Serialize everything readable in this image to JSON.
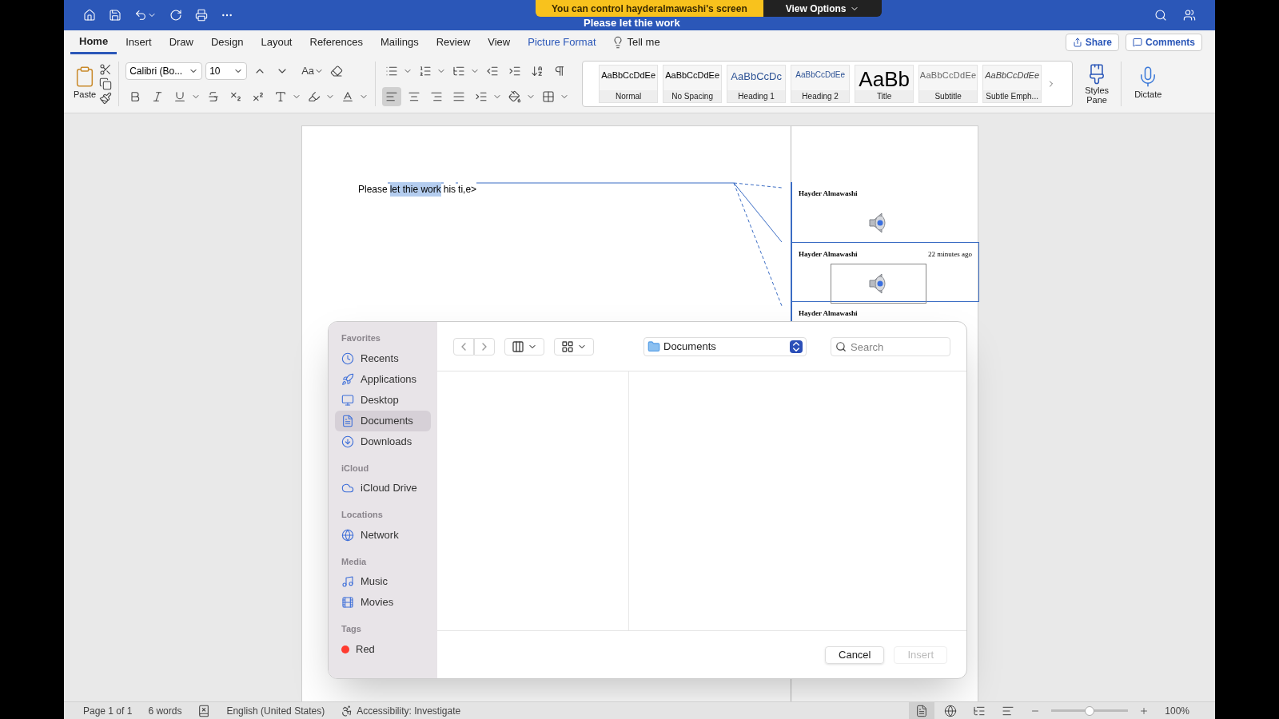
{
  "banner": {
    "message": "You can control hayderalmawashi's screen",
    "options": "View Options"
  },
  "window": {
    "title": "Please let thie work"
  },
  "tabs": [
    {
      "label": "Home",
      "selected": true,
      "contextual": false
    },
    {
      "label": "Insert",
      "selected": false,
      "contextual": false
    },
    {
      "label": "Draw",
      "selected": false,
      "contextual": false
    },
    {
      "label": "Design",
      "selected": false,
      "contextual": false
    },
    {
      "label": "Layout",
      "selected": false,
      "contextual": false
    },
    {
      "label": "References",
      "selected": false,
      "contextual": false
    },
    {
      "label": "Mailings",
      "selected": false,
      "contextual": false
    },
    {
      "label": "Review",
      "selected": false,
      "contextual": false
    },
    {
      "label": "View",
      "selected": false,
      "contextual": false
    },
    {
      "label": "Picture Format",
      "selected": false,
      "contextual": true
    }
  ],
  "tell_me": "Tell me",
  "share": "Share",
  "comments_button": "Comments",
  "ribbon": {
    "paste": "Paste",
    "font": "Calibri (Bo...",
    "size": "10",
    "case": "Aa",
    "styles_pane": "Styles Pane",
    "dictate": "Dictate",
    "styles": [
      {
        "preview": "AaBbCcDdEe",
        "name": "Normal",
        "kind": "normal"
      },
      {
        "preview": "AaBbCcDdEe",
        "name": "No Spacing",
        "kind": "normal"
      },
      {
        "preview": "AaBbCcDc",
        "name": "Heading 1",
        "kind": "heading1"
      },
      {
        "preview": "AaBbCcDdEe",
        "name": "Heading 2",
        "kind": "heading2"
      },
      {
        "preview": "AaBb",
        "name": "Title",
        "kind": "title"
      },
      {
        "preview": "AaBbCcDdEe",
        "name": "Subtitle",
        "kind": "subtitle"
      },
      {
        "preview": "AaBbCcDdEe",
        "name": "Subtle Emph...",
        "kind": "emphasis"
      }
    ]
  },
  "document": {
    "segments": [
      {
        "text": "Please",
        "selected": false
      },
      {
        "text": "let thie work",
        "selected": true
      },
      {
        "text": "his",
        "selected": false
      },
      {
        "text": "ti,e>",
        "selected": false
      }
    ],
    "comments": [
      {
        "author": "Hayder Almawashi",
        "active": false
      },
      {
        "author": "Hayder Almawashi",
        "time": "22 minutes ago",
        "active": true
      },
      {
        "author": "Hayder Almawashi",
        "active": false
      }
    ]
  },
  "dialog": {
    "location": "Documents",
    "search_placeholder": "Search",
    "sections": [
      {
        "title": "Favorites",
        "items": [
          {
            "label": "Recents",
            "kind": "recents",
            "selected": false
          },
          {
            "label": "Applications",
            "kind": "applications",
            "selected": false
          },
          {
            "label": "Desktop",
            "kind": "desktop",
            "selected": false
          },
          {
            "label": "Documents",
            "kind": "documents",
            "selected": true
          },
          {
            "label": "Downloads",
            "kind": "downloads",
            "selected": false
          }
        ]
      },
      {
        "title": "iCloud",
        "items": [
          {
            "label": "iCloud Drive",
            "kind": "cloud",
            "selected": false
          }
        ]
      },
      {
        "title": "Locations",
        "items": [
          {
            "label": "Network",
            "kind": "network",
            "selected": false
          }
        ]
      },
      {
        "title": "Media",
        "items": [
          {
            "label": "Music",
            "kind": "music",
            "selected": false
          },
          {
            "label": "Movies",
            "kind": "movies",
            "selected": false
          }
        ]
      },
      {
        "title": "Tags",
        "items": [
          {
            "label": "Red",
            "kind": "tag",
            "color": "#ff3b30",
            "selected": false
          }
        ]
      }
    ],
    "cancel": "Cancel",
    "insert": {
      "label": "Insert",
      "disabled": true
    }
  },
  "status_bar": {
    "page": "Page 1 of 1",
    "words": "6 words",
    "language": "English (United States)",
    "accessibility": "Accessibility: Investigate",
    "zoom": "100%",
    "zoom_slider": {
      "level": 0.5
    },
    "views": [
      {
        "kind": "print",
        "selected": true
      },
      {
        "kind": "web",
        "selected": false
      },
      {
        "kind": "outline",
        "selected": false
      },
      {
        "kind": "draft",
        "selected": false
      }
    ]
  }
}
